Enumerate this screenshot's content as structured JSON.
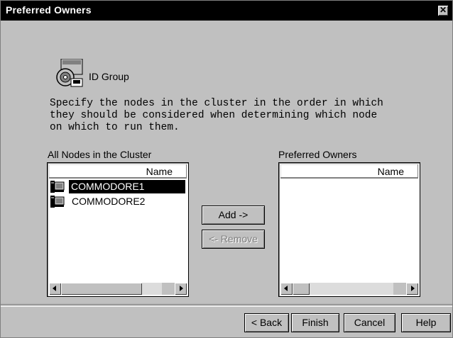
{
  "window": {
    "title": "Preferred Owners",
    "close_label": "✕"
  },
  "group": {
    "icon": "cluster-group-icon",
    "label": "ID Group"
  },
  "description": "Specify the nodes in the cluster in the order in which\nthey should be considered when determining which node\non which to run them.",
  "all_nodes": {
    "label": "All Nodes in the Cluster",
    "column": "Name",
    "items": [
      {
        "name": "COMMODORE1",
        "icon": "computer-icon",
        "selected": true
      },
      {
        "name": "COMMODORE2",
        "icon": "computer-icon",
        "selected": false
      }
    ]
  },
  "preferred": {
    "label": "Preferred Owners",
    "column": "Name",
    "items": []
  },
  "buttons": {
    "add": "Add ->",
    "remove": "<- Remove",
    "back": "< Back",
    "finish": "Finish",
    "cancel": "Cancel",
    "help": "Help"
  },
  "colors": {
    "title_bar": "#000000",
    "dialog": "#c0c0c0",
    "selection": "#000000"
  }
}
